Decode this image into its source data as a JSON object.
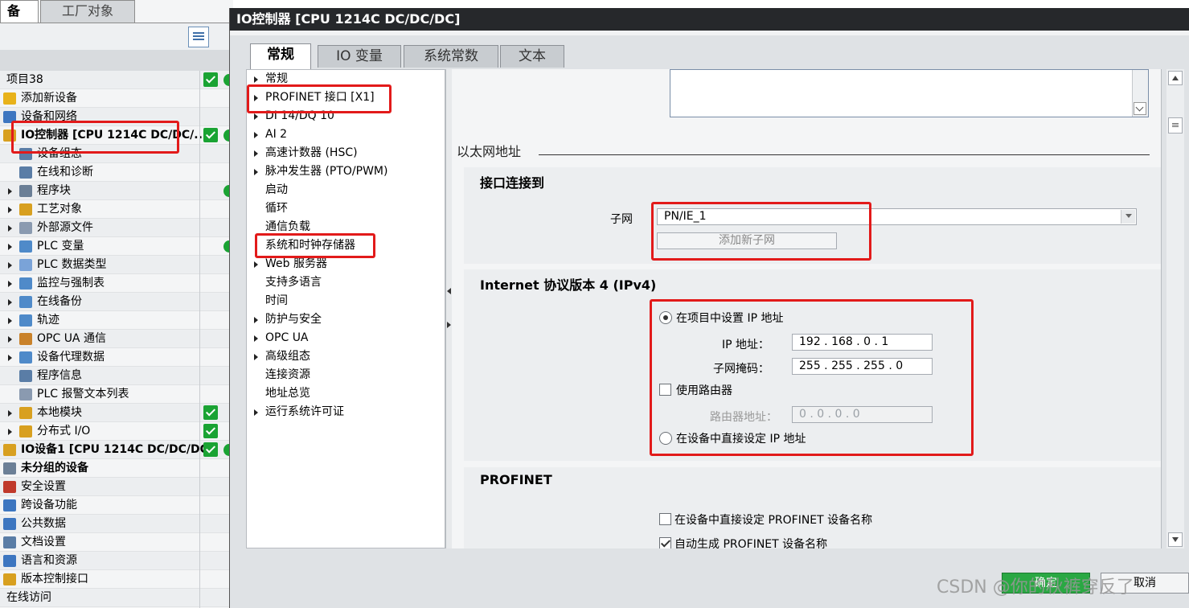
{
  "left_panel": {
    "tabs": [
      "备",
      "工厂对象"
    ],
    "tree": [
      {
        "label": "项目38",
        "check": true,
        "dot": true,
        "alt": true
      },
      {
        "label": "添加新设备",
        "icon": "#e8b21a"
      },
      {
        "label": "设备和网络",
        "icon": "#3d76c0",
        "alt": true
      },
      {
        "label": "IO控制器 [CPU 1214C DC/DC/...",
        "icon": "#d8a020",
        "bold": true,
        "check": true,
        "dot": true
      },
      {
        "label": "设备组态",
        "icon": "#5a7da6",
        "indent": 2,
        "alt": true
      },
      {
        "label": "在线和诊断",
        "icon": "#5a7da6",
        "indent": 2
      },
      {
        "label": "程序块",
        "icon": "#6b7f96",
        "arrow": true,
        "indent": 2,
        "dot": true,
        "alt": true
      },
      {
        "label": "工艺对象",
        "icon": "#d8a020",
        "arrow": true,
        "indent": 2
      },
      {
        "label": "外部源文件",
        "icon": "#8a9ab0",
        "arrow": true,
        "indent": 2,
        "alt": true
      },
      {
        "label": "PLC 变量",
        "icon": "#4f8ac9",
        "arrow": true,
        "indent": 2,
        "dot": true
      },
      {
        "label": "PLC 数据类型",
        "icon": "#7aa3d8",
        "arrow": true,
        "indent": 2,
        "alt": true
      },
      {
        "label": "监控与强制表",
        "icon": "#4f8ac9",
        "arrow": true,
        "indent": 2
      },
      {
        "label": "在线备份",
        "icon": "#4f8ac9",
        "arrow": true,
        "indent": 2,
        "alt": true
      },
      {
        "label": "轨迹",
        "icon": "#4f8ac9",
        "arrow": true,
        "indent": 2
      },
      {
        "label": "OPC UA 通信",
        "icon": "#c9822a",
        "arrow": true,
        "indent": 2,
        "alt": true
      },
      {
        "label": "设备代理数据",
        "icon": "#4f8ac9",
        "arrow": true,
        "indent": 2
      },
      {
        "label": "程序信息",
        "icon": "#5a7da6",
        "indent": 2,
        "alt": true
      },
      {
        "label": "PLC 报警文本列表",
        "icon": "#8a9ab0",
        "indent": 2
      },
      {
        "label": "本地模块",
        "icon": "#d8a020",
        "arrow": true,
        "indent": 2,
        "check": true,
        "alt": true
      },
      {
        "label": "分布式 I/O",
        "icon": "#d8a020",
        "arrow": true,
        "indent": 2,
        "check": true
      },
      {
        "label": "IO设备1 [CPU 1214C DC/DC/DC]",
        "icon": "#d8a020",
        "bold": true,
        "check": true,
        "dot": true,
        "alt": true
      },
      {
        "label": "未分组的设备",
        "icon": "#6b7f96",
        "bold": true
      },
      {
        "label": "安全设置",
        "icon": "#c0392b",
        "alt": true
      },
      {
        "label": "跨设备功能",
        "icon": "#3d76c0"
      },
      {
        "label": "公共数据",
        "icon": "#3d76c0",
        "alt": true
      },
      {
        "label": "文档设置",
        "icon": "#5a7da6"
      },
      {
        "label": "语言和资源",
        "icon": "#3d76c0",
        "alt": true
      },
      {
        "label": "版本控制接口",
        "icon": "#d8a020"
      },
      {
        "label": "在线访问",
        "icon": "",
        "alt": true
      }
    ]
  },
  "dialog": {
    "title": "IO控制器 [CPU 1214C DC/DC/DC]",
    "tabs": [
      "常规",
      "IO 变量",
      "系统常数",
      "文本"
    ],
    "nav": [
      {
        "label": "常规",
        "arrow": true
      },
      {
        "label": "PROFINET 接口 [X1]",
        "arrow": true
      },
      {
        "label": "DI 14/DQ 10",
        "arrow": true
      },
      {
        "label": "AI 2",
        "arrow": true
      },
      {
        "label": "高速计数器 (HSC)",
        "arrow": true
      },
      {
        "label": "脉冲发生器 (PTO/PWM)",
        "arrow": true
      },
      {
        "label": "启动",
        "arrow": false
      },
      {
        "label": "循环",
        "arrow": false
      },
      {
        "label": "通信负载",
        "arrow": false
      },
      {
        "label": "系统和时钟存储器",
        "arrow": false
      },
      {
        "label": "Web 服务器",
        "arrow": true
      },
      {
        "label": "支持多语言",
        "arrow": false
      },
      {
        "label": "时间",
        "arrow": false
      },
      {
        "label": "防护与安全",
        "arrow": true
      },
      {
        "label": "OPC UA",
        "arrow": true
      },
      {
        "label": "高级组态",
        "arrow": true
      },
      {
        "label": "连接资源",
        "arrow": false
      },
      {
        "label": "地址总览",
        "arrow": false
      },
      {
        "label": "运行系统许可证",
        "arrow": true
      }
    ],
    "ethernet_title": "以太网地址",
    "interface": {
      "header": "接口连接到",
      "subnet_label": "子网",
      "subnet_value": "PN/IE_1",
      "add_subnet": "添加新子网"
    },
    "ipv4": {
      "header": "Internet 协议版本 4 (IPv4)",
      "opt_project": "在项目中设置 IP 地址",
      "ip_label": "IP 地址：",
      "ip_value": "192 . 168 . 0    . 1",
      "mask_label": "子网掩码：",
      "mask_value": "255 . 255 . 255 . 0",
      "use_router": "使用路由器",
      "router_label": "路由器地址：",
      "router_value": "0     . 0     . 0     . 0",
      "opt_device": "在设备中直接设定 IP 地址"
    },
    "profinet": {
      "header": "PROFINET",
      "opt_direct_name": "在设备中直接设定 PROFINET 设备名称",
      "opt_auto_name": "自动生成 PROFINET 设备名称"
    },
    "buttons": {
      "ok": "确定",
      "cancel": "取消"
    }
  },
  "watermark": "CSDN @你的秋裤穿反了",
  "colors": {
    "highlight": "#e21a1a",
    "check_green": "#1aa333",
    "titlebar": "#26282b"
  }
}
